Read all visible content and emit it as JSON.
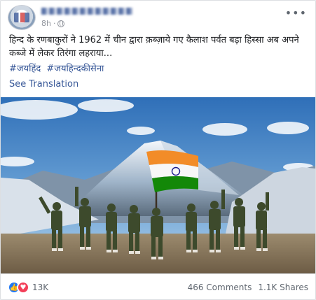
{
  "post": {
    "time": "8h",
    "text": "हिन्द के रणबाकुरों ने 1962 में चीन द्वारा क़ब्ज़ाये गए कैलाश पर्वत बड़ा हिस्सा अब अपने कब्जे में लेकर तिरंगा लहराया...",
    "hashtags": [
      "#जयहिंद",
      "#जयहिन्दकीसेना"
    ],
    "see_translation": "See Translation"
  },
  "footer": {
    "reaction_count": "13K",
    "comments": "466 Comments",
    "shares": "1.1K Shares"
  },
  "colors": {
    "link": "#385898",
    "like": "#2078f4",
    "love": "#f33e58",
    "saffron": "#f28c28",
    "green": "#138808",
    "chakra": "#1a1a8c"
  },
  "icons": {
    "more": "more-options-icon",
    "privacy": "globe-icon",
    "like": "like-reaction-icon",
    "love": "love-reaction-icon"
  }
}
